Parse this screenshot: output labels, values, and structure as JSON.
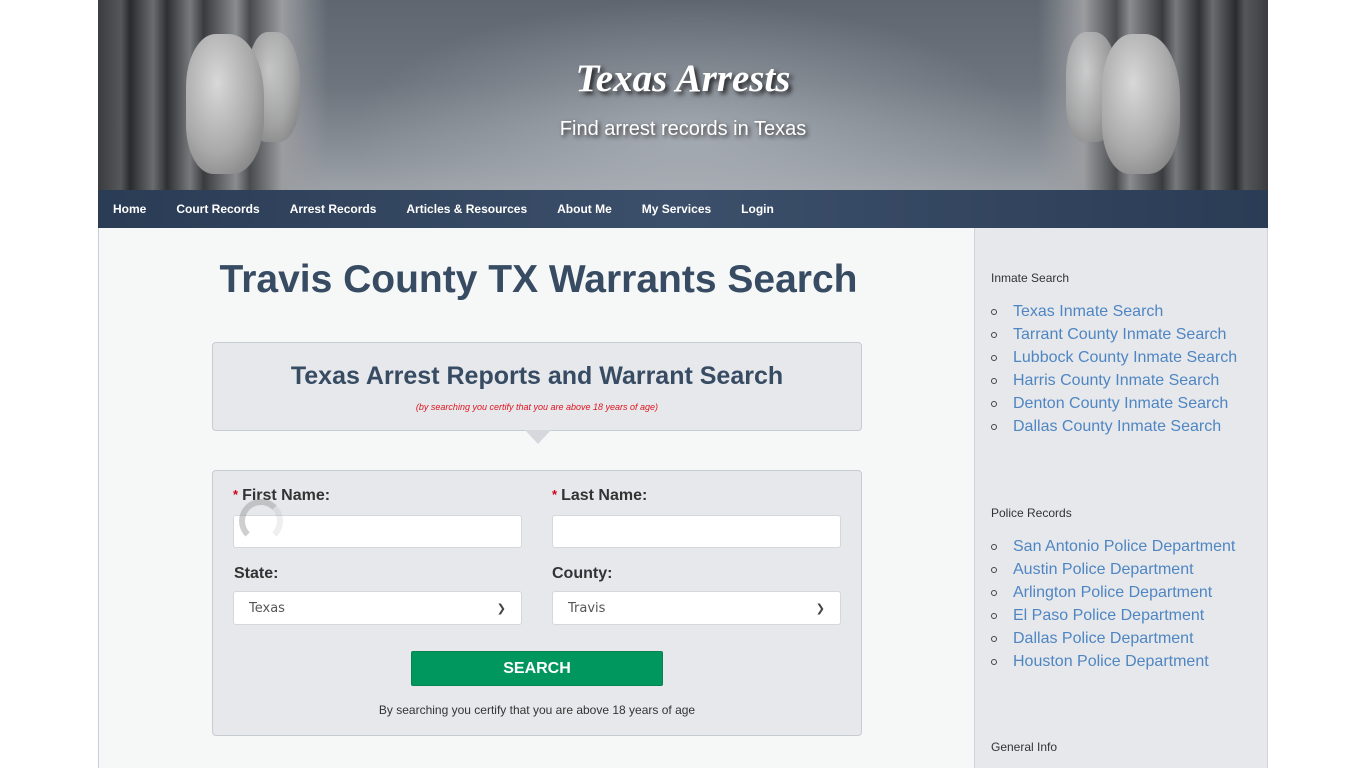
{
  "header": {
    "title": "Texas Arrests",
    "tagline": "Find arrest records in Texas"
  },
  "nav": {
    "items": [
      {
        "label": "Home"
      },
      {
        "label": "Court Records"
      },
      {
        "label": "Arrest Records"
      },
      {
        "label": "Articles & Resources"
      },
      {
        "label": "About Me"
      },
      {
        "label": "My Services"
      },
      {
        "label": "Login"
      }
    ]
  },
  "main": {
    "page_title": "Travis County TX Warrants Search",
    "search_box": {
      "heading": "Texas Arrest Reports and Warrant Search",
      "disclaimer": "(by searching you certify that you are above 18 years of age)"
    },
    "form": {
      "required_marker": "*",
      "first_name_label": "First Name:",
      "first_name_value": "",
      "last_name_label": "Last Name:",
      "last_name_value": "",
      "state_label": "State:",
      "state_value": "Texas",
      "county_label": "County:",
      "county_value": "Travis",
      "search_button": "SEARCH",
      "note": "By searching you certify that you are above 18 years of age"
    }
  },
  "sidebar": {
    "widgets": [
      {
        "title": "Inmate Search",
        "links": [
          "Texas Inmate Search",
          "Tarrant County Inmate Search",
          "Lubbock County Inmate Search",
          "Harris County Inmate Search",
          "Denton County Inmate Search",
          "Dallas County Inmate Search"
        ]
      },
      {
        "title": "Police Records",
        "links": [
          "San Antonio Police Department",
          "Austin Police Department",
          "Arlington Police Department",
          "El Paso Police Department",
          "Dallas Police Department",
          "Houston Police Department"
        ]
      },
      {
        "title": "General Info",
        "links": []
      }
    ]
  },
  "colors": {
    "nav_bg": "#2d425f",
    "title_text": "#374b63",
    "search_button": "#00975f",
    "link": "#4f86c2",
    "disclaimer": "#e0131f"
  }
}
